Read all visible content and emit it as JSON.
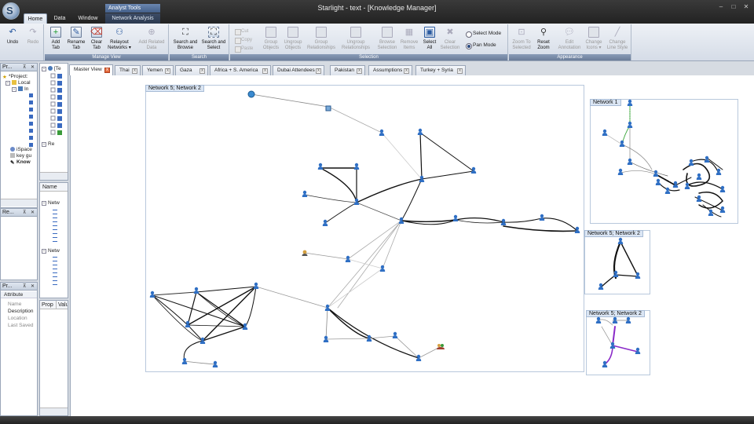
{
  "window": {
    "title": "Starlight - text - [Knowledge Manager]",
    "contextual_group": "Analyst Tools"
  },
  "ribbon_tabs": [
    "Home",
    "Data",
    "Window",
    "Network Analysis"
  ],
  "ribbon": {
    "groups": {
      "manage_view": "Manage View",
      "search": "Search",
      "selection": "Selection",
      "appearance": "Appearance"
    },
    "buttons": {
      "undo": "Undo",
      "redo": "Redo",
      "add_tab": [
        "Add",
        "Tab"
      ],
      "rename_tab": [
        "Rename",
        "Tab"
      ],
      "clear_tab": [
        "Clear",
        "Tab"
      ],
      "relayout": [
        "Relayout",
        "Networks ▾"
      ],
      "add_related": [
        "Add Related",
        "Data"
      ],
      "search_browse": [
        "Search and",
        "Browse"
      ],
      "search_select": [
        "Search and",
        "Select"
      ],
      "cut": "Cut",
      "copy": "Copy",
      "paste": "Paste",
      "group_objects": [
        "Group",
        "Objects"
      ],
      "ungroup_objects": [
        "Ungroup",
        "Objects"
      ],
      "group_relationships": [
        "Group",
        "Relationships"
      ],
      "ungroup_relationships": [
        "Ungroup",
        "Relationships"
      ],
      "browse_selection": [
        "Browse",
        "Selection"
      ],
      "remove_items": [
        "Remove",
        "Items"
      ],
      "select_all": [
        "Select",
        "All"
      ],
      "clear_selection": [
        "Clear",
        "Selection"
      ],
      "select_mode": "Select Mode",
      "pan_mode": "Pan Mode",
      "zoom_selected": [
        "Zoom To",
        "Selected"
      ],
      "reset_zoom": [
        "Reset",
        "Zoom"
      ],
      "edit_annotation": [
        "Edit",
        "Annotation"
      ],
      "change_icons": [
        "Change",
        "Icons ▾"
      ],
      "change_line_style": [
        "Change",
        "Line Style"
      ]
    }
  },
  "left_panel": {
    "project_title": "Pr...",
    "project_items": [
      "*Project:",
      "Local",
      "In",
      "iSpace",
      "key gu",
      "Know"
    ],
    "re_title": "Re...",
    "props_title": "Pr...",
    "attr_header": "Attribute",
    "attributes": [
      "Name",
      "Description",
      "Location",
      "Last Saved"
    ]
  },
  "mid_panel": {
    "tree_top": "[Te",
    "tree_re": "Re",
    "name_header": "Name",
    "net_items": [
      "Netw",
      "Netw"
    ],
    "prop_header": "Prop",
    "value_header": "Valu"
  },
  "doc_tabs": [
    "Master View",
    "Thai",
    "Yemen",
    "Gaza",
    "Africa + S. America",
    "Dubai Attendees",
    "Pakistan",
    "Assumptions",
    "Turkey + Syria"
  ],
  "networks": [
    {
      "label": "Network 5; Network 2"
    },
    {
      "label": "Network 1"
    },
    {
      "label": "Network 5; Network 2"
    },
    {
      "label": "Network 5; Network 2"
    }
  ],
  "colors": {
    "node": "#2f6fc4",
    "edge_dark": "#111111",
    "edge_light": "#aaaaaa",
    "edge_green": "#3aa63a",
    "edge_purple": "#8a2ac8",
    "net_label_bg": "#dbe6f4"
  }
}
